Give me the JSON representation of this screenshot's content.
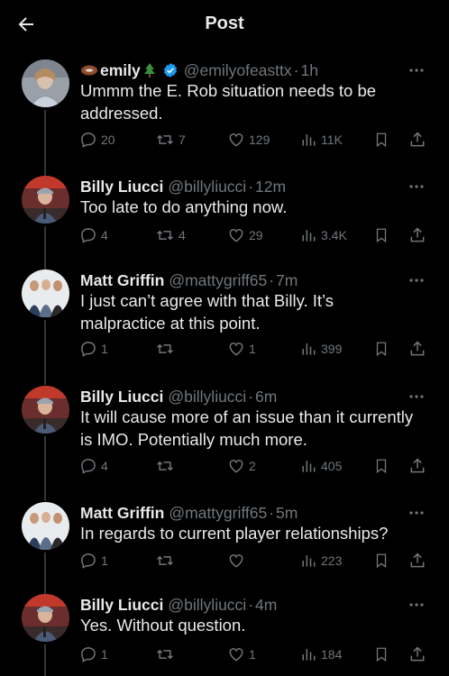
{
  "header": {
    "title": "Post"
  },
  "tweets": [
    {
      "name": "emily",
      "handle": "@emilyofeasttx",
      "time": "1h",
      "sep": "·",
      "text": "Ummm the E. Rob situation needs to be addressed.",
      "replies": "20",
      "retweets": "7",
      "likes": "129",
      "views": "11K",
      "verified": true
    },
    {
      "name": "Billy Liucci",
      "handle": "@billyliucci",
      "time": "12m",
      "sep": "·",
      "text": "Too late to do anything now.",
      "replies": "4",
      "retweets": "4",
      "likes": "29",
      "views": "3.4K"
    },
    {
      "name": "Matt Griffin",
      "handle": "@mattygriff65",
      "time": "7m",
      "sep": "·",
      "text": "I just can’t agree with that Billy. It’s malpractice at this point.",
      "replies": "1",
      "retweets": "",
      "likes": "1",
      "views": "399"
    },
    {
      "name": "Billy Liucci",
      "handle": "@billyliucci",
      "time": "6m",
      "sep": "·",
      "text": "It will cause more of an issue than it currently is IMO. Potentially much more.",
      "replies": "4",
      "retweets": "",
      "likes": "2",
      "views": "405"
    },
    {
      "name": "Matt Griffin",
      "handle": "@mattygriff65",
      "time": "5m",
      "sep": "·",
      "text": "In regards to current player relationships?",
      "replies": "1",
      "retweets": "",
      "likes": "",
      "views": "223"
    },
    {
      "name": "Billy Liucci",
      "handle": "@billyliucci",
      "time": "4m",
      "sep": "·",
      "text": "Yes. Without question.",
      "replies": "1",
      "retweets": "",
      "likes": "1",
      "views": "184"
    }
  ],
  "colors": {
    "background": "#000000",
    "text": "#e7e9ea",
    "muted": "#71767b",
    "verified": "#1d9bf0",
    "thread_line": "#333639"
  }
}
